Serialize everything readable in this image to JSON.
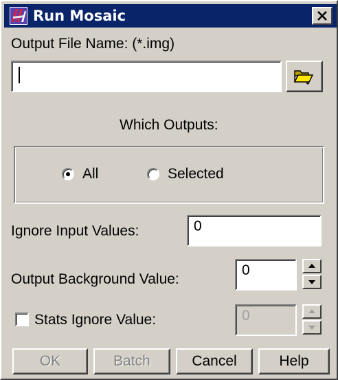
{
  "window": {
    "title": "Run Mosaic",
    "icons": {
      "app": "mosaic-app-icon",
      "close": "close-icon"
    }
  },
  "output_file": {
    "label": "Output File Name: (*.img)",
    "value": "",
    "browse_icon": "folder-open-icon"
  },
  "which_outputs": {
    "label": "Which Outputs:",
    "options": [
      {
        "label": "All",
        "selected": true
      },
      {
        "label": "Selected",
        "selected": false
      }
    ]
  },
  "ignore_input": {
    "label": "Ignore Input Values:",
    "value": "0"
  },
  "output_background": {
    "label": "Output Background Value:",
    "value": "0"
  },
  "stats_ignore": {
    "label": "Stats Ignore Value:",
    "checked": false,
    "value": "0",
    "enabled": false
  },
  "buttons": {
    "ok": "OK",
    "batch": "Batch",
    "cancel": "Cancel",
    "help": "Help"
  },
  "colors": {
    "titlebar": "#0a246a",
    "face": "#d4d0c8",
    "disabled_text": "#808080"
  }
}
